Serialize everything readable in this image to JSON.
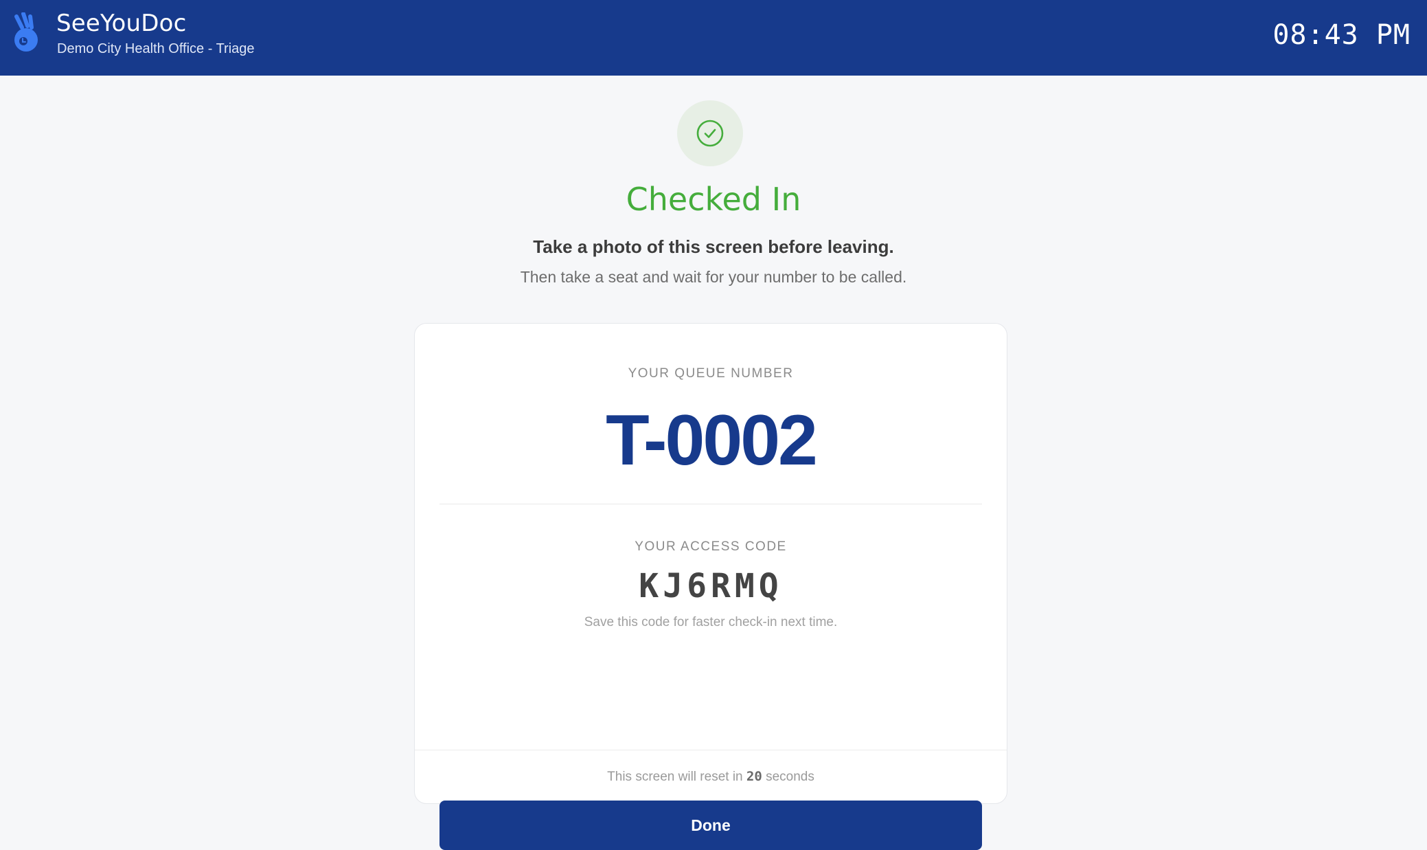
{
  "header": {
    "brand_name": "SeeYouDoc",
    "subtitle": "Demo City Health Office - Triage",
    "clock": "08:43 PM",
    "logo_icon": "hand-logo-icon",
    "background_color": "#173a8c"
  },
  "status": {
    "icon": "check-circle-icon",
    "title": "Checked In",
    "instruction_primary": "Take a photo of this screen before leaving.",
    "instruction_secondary": "Then take a seat and wait for your number to be called.",
    "success_color": "#45ad3c"
  },
  "card": {
    "queue_label": "YOUR QUEUE NUMBER",
    "queue_number": "T-0002",
    "access_label": "YOUR ACCESS CODE",
    "access_code": "KJ6RMQ",
    "access_note": "Save this code for faster check-in next time.",
    "reset_prefix": "This screen will reset in",
    "reset_seconds": "20",
    "reset_suffix": "seconds",
    "done_label": "Done",
    "accent_color": "#173a8c"
  }
}
